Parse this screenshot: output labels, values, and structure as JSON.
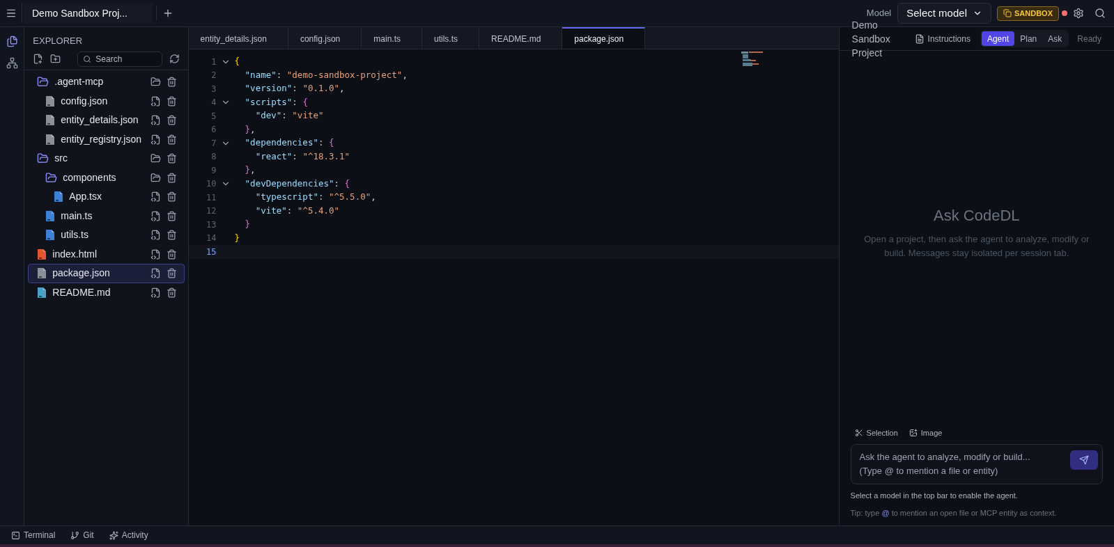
{
  "session_tabs": [
    {
      "label": "Demo Sandbox Proj...",
      "selected": true
    }
  ],
  "activity_bar": [
    {
      "kind": "files",
      "selected": true
    },
    {
      "kind": "graph",
      "selected": false
    }
  ],
  "explorer": {
    "title": "EXPLORER",
    "search": {
      "placeholder": "Search"
    },
    "tree": [
      {
        "name": ".agent-mcp",
        "kind": "folder",
        "selected": false,
        "children": [
          {
            "name": "config.json",
            "kind": "json",
            "selected": false
          },
          {
            "name": "entity_details.json",
            "kind": "json",
            "selected": false
          },
          {
            "name": "entity_registry.json",
            "kind": "json",
            "selected": false
          }
        ]
      },
      {
        "name": "src",
        "kind": "folder",
        "selected": false,
        "children": [
          {
            "name": "components",
            "kind": "folder",
            "selected": false,
            "children": [
              {
                "name": "App.tsx",
                "kind": "code",
                "selected": false
              }
            ]
          },
          {
            "name": "main.ts",
            "kind": "code",
            "selected": false
          },
          {
            "name": "utils.ts",
            "kind": "code",
            "selected": false
          }
        ]
      },
      {
        "name": "index.html",
        "kind": "html",
        "selected": false
      },
      {
        "name": "package.json",
        "kind": "json",
        "selected": true
      },
      {
        "name": "README.md",
        "kind": "md",
        "selected": false
      }
    ]
  },
  "editor_tabs": [
    {
      "label": "entity_details.json",
      "selected": false
    },
    {
      "label": "config.json",
      "selected": false
    },
    {
      "label": "main.ts",
      "selected": false
    },
    {
      "label": "utils.ts",
      "selected": false
    },
    {
      "label": "README.md",
      "selected": false
    },
    {
      "label": "package.json",
      "selected": true
    }
  ],
  "code_lines": [
    {
      "number": "1",
      "fold": true,
      "current": false,
      "tokens": [
        {
          "kind": "brace1",
          "text": "{"
        }
      ]
    },
    {
      "number": "2",
      "fold": false,
      "current": false,
      "tokens": [
        {
          "kind": "key",
          "text": "  \"name\""
        },
        {
          "kind": "punct",
          "text": ": "
        },
        {
          "kind": "string",
          "text": "\"demo-sandbox-project\""
        },
        {
          "kind": "punct",
          "text": ","
        }
      ]
    },
    {
      "number": "3",
      "fold": false,
      "current": false,
      "tokens": [
        {
          "kind": "key",
          "text": "  \"version\""
        },
        {
          "kind": "punct",
          "text": ": "
        },
        {
          "kind": "string",
          "text": "\"0.1.0\""
        },
        {
          "kind": "punct",
          "text": ","
        }
      ]
    },
    {
      "number": "4",
      "fold": true,
      "current": false,
      "tokens": [
        {
          "kind": "key",
          "text": "  \"scripts\""
        },
        {
          "kind": "punct",
          "text": ": "
        },
        {
          "kind": "brace2",
          "text": "{"
        }
      ]
    },
    {
      "number": "5",
      "fold": false,
      "current": false,
      "tokens": [
        {
          "kind": "key",
          "text": "    \"dev\""
        },
        {
          "kind": "punct",
          "text": ": "
        },
        {
          "kind": "string",
          "text": "\"vite\""
        }
      ]
    },
    {
      "number": "6",
      "fold": false,
      "current": false,
      "tokens": [
        {
          "kind": "brace2",
          "text": "  }"
        },
        {
          "kind": "punct",
          "text": ","
        }
      ]
    },
    {
      "number": "7",
      "fold": true,
      "current": false,
      "tokens": [
        {
          "kind": "key",
          "text": "  \"dependencies\""
        },
        {
          "kind": "punct",
          "text": ": "
        },
        {
          "kind": "brace2",
          "text": "{"
        }
      ]
    },
    {
      "number": "8",
      "fold": false,
      "current": false,
      "tokens": [
        {
          "kind": "key",
          "text": "    \"react\""
        },
        {
          "kind": "punct",
          "text": ": "
        },
        {
          "kind": "string",
          "text": "\"^18.3.1\""
        }
      ]
    },
    {
      "number": "9",
      "fold": false,
      "current": false,
      "tokens": [
        {
          "kind": "brace2",
          "text": "  }"
        },
        {
          "kind": "punct",
          "text": ","
        }
      ]
    },
    {
      "number": "10",
      "fold": true,
      "current": false,
      "tokens": [
        {
          "kind": "key",
          "text": "  \"devDependencies\""
        },
        {
          "kind": "punct",
          "text": ": "
        },
        {
          "kind": "brace2",
          "text": "{"
        }
      ]
    },
    {
      "number": "11",
      "fold": false,
      "current": false,
      "tokens": [
        {
          "kind": "key",
          "text": "    \"typescript\""
        },
        {
          "kind": "punct",
          "text": ": "
        },
        {
          "kind": "string",
          "text": "\"^5.5.0\""
        },
        {
          "kind": "punct",
          "text": ","
        }
      ]
    },
    {
      "number": "12",
      "fold": false,
      "current": false,
      "tokens": [
        {
          "kind": "key",
          "text": "    \"vite\""
        },
        {
          "kind": "punct",
          "text": ": "
        },
        {
          "kind": "string",
          "text": "\"^5.4.0\""
        }
      ]
    },
    {
      "number": "13",
      "fold": false,
      "current": false,
      "tokens": [
        {
          "kind": "brace2",
          "text": "  }"
        }
      ]
    },
    {
      "number": "14",
      "fold": false,
      "current": false,
      "tokens": [
        {
          "kind": "brace1",
          "text": "}"
        }
      ]
    },
    {
      "number": "15",
      "fold": false,
      "current": true
    }
  ],
  "top_bar": {
    "model_label": "Model",
    "model_select": "Select model",
    "sandbox_badge": "SANDBOX",
    "status_dot": {
      "color": "#f87171"
    }
  },
  "chat": {
    "project_title": "Demo Sandbox Project",
    "instructions": "Instructions",
    "modes": [
      {
        "label": "Agent",
        "selected": true
      },
      {
        "label": "Plan",
        "selected": false
      },
      {
        "label": "Ask",
        "selected": false
      }
    ],
    "status": "Ready",
    "empty_title": "Ask CodeDL",
    "empty_text": "Open a project, then ask the agent to analyze, modify or build. Messages stay isolated per session tab.",
    "attach": [
      {
        "kind": "selection",
        "label": "Selection"
      },
      {
        "kind": "image",
        "label": "Image"
      }
    ],
    "input_placeholder": "Ask the agent to analyze, modify or build...\n(Type @ to mention a file or entity)",
    "hint": "Select a model in the top bar to enable the agent.",
    "tip": {
      "before": "Tip: type",
      "mention": "@",
      "after": "to mention an open file or MCP entity as context."
    }
  },
  "bottom_bar": [
    {
      "kind": "terminal",
      "label": "Terminal"
    },
    {
      "kind": "git",
      "label": "Git"
    },
    {
      "kind": "activity",
      "label": "Activity"
    }
  ]
}
